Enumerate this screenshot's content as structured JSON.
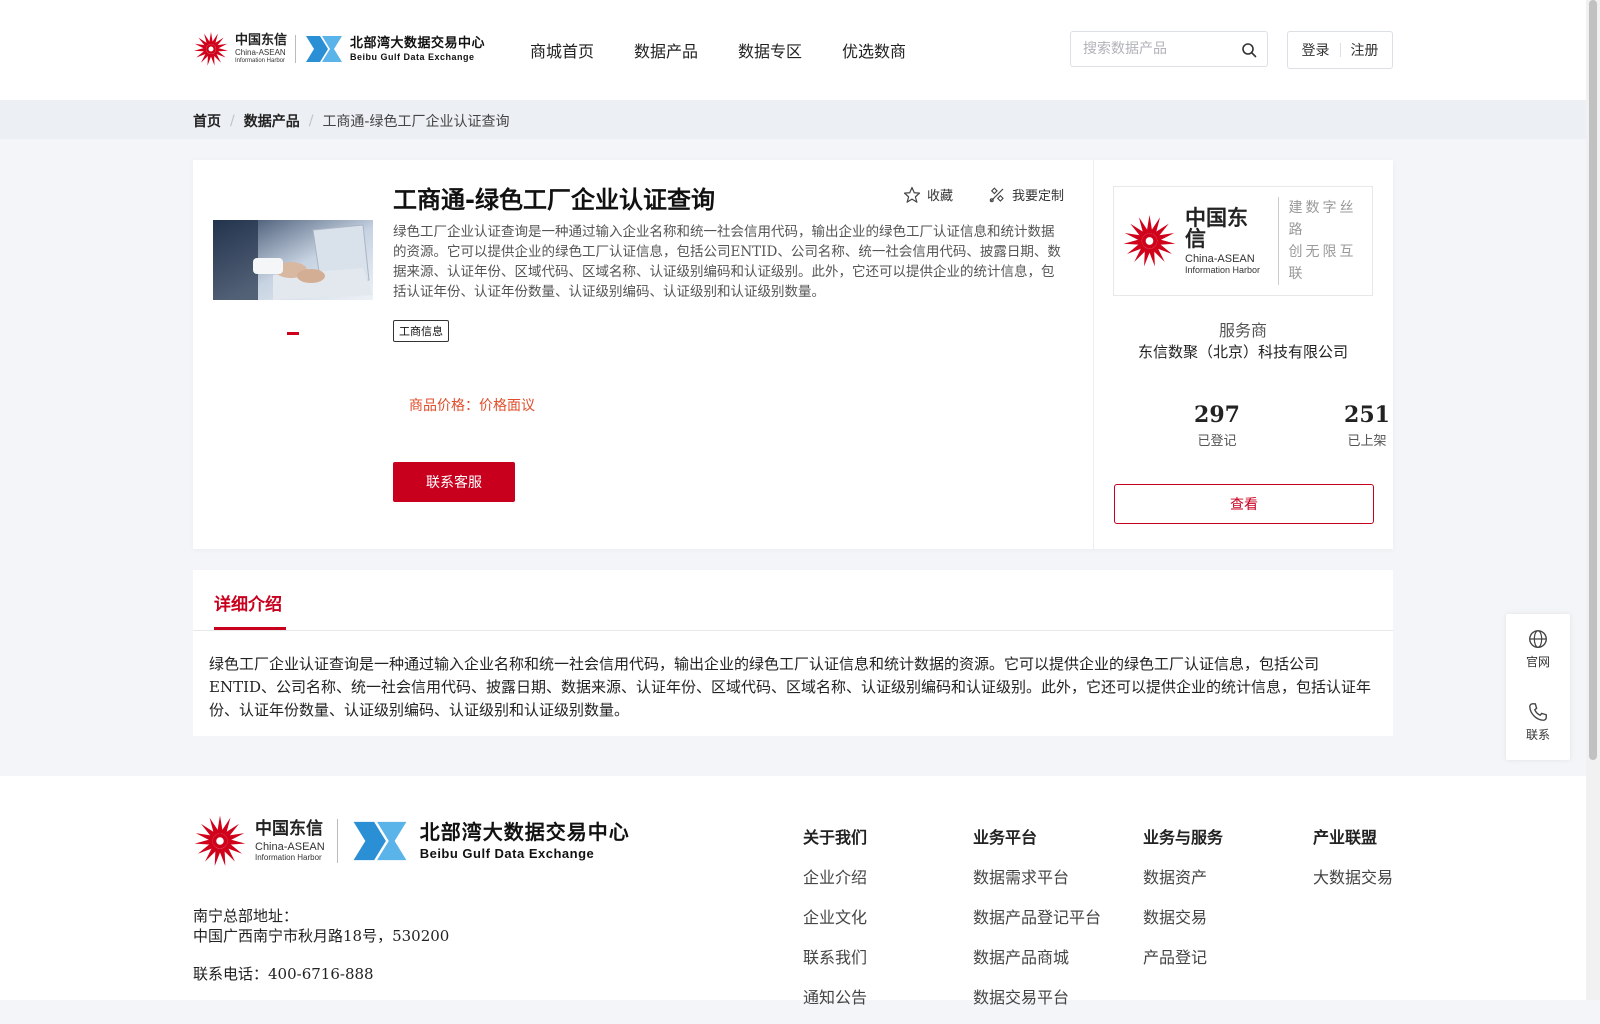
{
  "header": {
    "logo_cta": {
      "cn": "中国东信",
      "en1": "China-ASEAN",
      "en2": "Information Harbor"
    },
    "logo_bbdx": {
      "cn": "北部湾大数据交易中心",
      "en": "Beibu Gulf Data Exchange"
    },
    "nav": [
      {
        "label": "商城首页"
      },
      {
        "label": "数据产品"
      },
      {
        "label": "数据专区"
      },
      {
        "label": "优选数商"
      }
    ],
    "search": {
      "placeholder": "搜索数据产品",
      "value": ""
    },
    "login_label": "登录",
    "register_label": "注册"
  },
  "breadcrumb": {
    "home": "首页",
    "section": "数据产品",
    "current": "工商通-绿色工厂企业认证查询"
  },
  "product": {
    "title": "工商通-绿色工厂企业认证查询",
    "favorite_label": "收藏",
    "customize_label": "我要定制",
    "description": "绿色工厂企业认证查询是一种通过输入企业名称和统一社会信用代码，输出企业的绿色工厂认证信息和统计数据的资源。它可以提供企业的绿色工厂认证信息，包括公司ENTID、公司名称、统一社会信用代码、披露日期、数据来源、认证年份、区域代码、区域名称、认证级别编码和认证级别。此外，它还可以提供企业的统计信息，包括认证年份、认证年份数量、认证级别编码、认证级别和认证级别数量。",
    "tag": "工商信息",
    "price_label": "商品价格：",
    "price_value": "价格面议",
    "contact_label": "联系客服"
  },
  "provider": {
    "logo_cn": "中国东信",
    "logo_en1": "China-ASEAN",
    "logo_en2": "Information Harbor",
    "slogan_line1": "建数字丝路",
    "slogan_line2": "创无限互联",
    "label": "服务商",
    "name": "东信数聚（北京）科技有限公司",
    "stats": [
      {
        "value": "297",
        "label": "已登记"
      },
      {
        "value": "251",
        "label": "已上架"
      }
    ],
    "view_label": "查看"
  },
  "detail": {
    "tab_label": "详细介绍",
    "text": "绿色工厂企业认证查询是一种通过输入企业名称和统一社会信用代码，输出企业的绿色工厂认证信息和统计数据的资源。它可以提供企业的绿色工厂认证信息，包括公司ENTID、公司名称、统一社会信用代码、披露日期、数据来源、认证年份、区域代码、区域名称、认证级别编码和认证级别。此外，它还可以提供企业的统计信息，包括认证年份、认证年份数量、认证级别编码、认证级别和认证级别数量。"
  },
  "float_panel": {
    "official_label": "官网",
    "contact_label": "联系"
  },
  "footer": {
    "address_label": "南宁总部地址：",
    "address": "中国广西南宁市秋月路18号，530200",
    "phone": "联系电话：400-6716-888",
    "columns": [
      {
        "title": "关于我们",
        "links": [
          "企业介绍",
          "企业文化",
          "联系我们",
          "通知公告"
        ]
      },
      {
        "title": "业务平台",
        "links": [
          "数据需求平台",
          "数据产品登记平台",
          "数据产品商城",
          "数据交易平台"
        ]
      },
      {
        "title": "业务与服务",
        "links": [
          "数据资产",
          "数据交易",
          "产品登记"
        ]
      },
      {
        "title": "产业联盟",
        "links": [
          "大数据交易"
        ]
      }
    ]
  },
  "colors": {
    "brand_red": "#c8001e",
    "price_orange": "#e04e2b",
    "bbdx_blue": "#2a8fd4"
  },
  "icons": [
    "search-icon",
    "star-icon",
    "customize-icon",
    "globe-icon",
    "phone-icon",
    "sunburst-logo-icon"
  ]
}
